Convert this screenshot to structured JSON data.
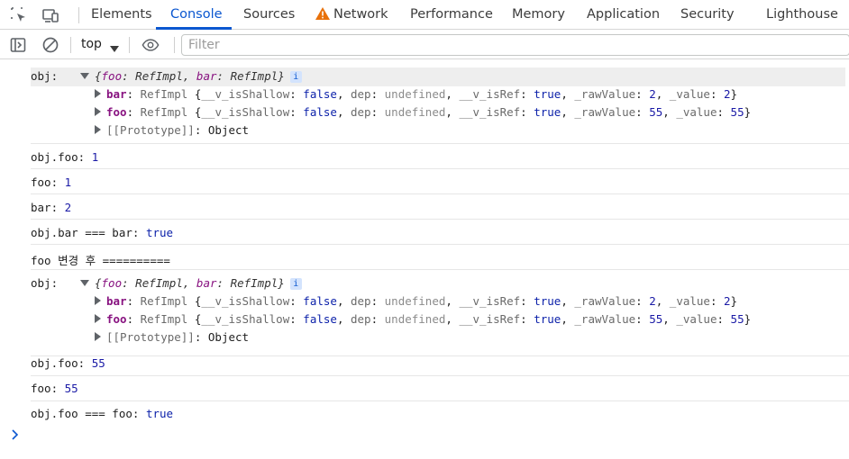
{
  "tabbar": {
    "tabs": [
      {
        "label": "Elements"
      },
      {
        "label": "Console"
      },
      {
        "label": "Sources"
      },
      {
        "label": "Network"
      },
      {
        "label": "Performance"
      },
      {
        "label": "Memory"
      },
      {
        "label": "Application"
      },
      {
        "label": "Security"
      },
      {
        "label": "Lighthouse"
      }
    ],
    "active_tab": "Console",
    "accent_color": "#0b57d0",
    "warning_color": "#e8710a"
  },
  "toolbar": {
    "context": "top",
    "filter_placeholder": "Filter"
  },
  "console": {
    "messages": [
      {
        "label": "obj:",
        "summary": {
          "open": "{",
          "k1": "foo",
          "v1": "RefImpl",
          "k2": "bar",
          "v2": "RefImpl",
          "close": "}",
          "info": "i"
        },
        "props": [
          {
            "key": "bar",
            "type": "RefImpl",
            "isShallow": "false",
            "dep": "undefined",
            "isRef": "true",
            "rawValue": "2",
            "value": "2"
          },
          {
            "key": "foo",
            "type": "RefImpl",
            "isShallow": "false",
            "dep": "undefined",
            "isRef": "true",
            "rawValue": "55",
            "value": "55"
          }
        ],
        "prototype": {
          "key": "[[Prototype]]",
          "value": "Object"
        }
      },
      {
        "label": "obj.foo:",
        "value": "1"
      },
      {
        "label": "foo:",
        "value": "1"
      },
      {
        "label": "bar:",
        "value": "2"
      },
      {
        "label": "obj.bar === bar:",
        "value": "true"
      },
      {
        "label": "foo 변경 후 =========="
      },
      {
        "label": "obj:",
        "summary": {
          "open": "{",
          "k1": "foo",
          "v1": "RefImpl",
          "k2": "bar",
          "v2": "RefImpl",
          "close": "}",
          "info": "i"
        },
        "props": [
          {
            "key": "bar",
            "type": "RefImpl",
            "isShallow": "false",
            "dep": "undefined",
            "isRef": "true",
            "rawValue": "2",
            "value": "2"
          },
          {
            "key": "foo",
            "type": "RefImpl",
            "isShallow": "false",
            "dep": "undefined",
            "isRef": "true",
            "rawValue": "55",
            "value": "55"
          }
        ],
        "prototype": {
          "key": "[[Prototype]]",
          "value": "Object"
        }
      },
      {
        "label": "obj.foo:",
        "value": "55"
      },
      {
        "label": "foo:",
        "value": "55"
      },
      {
        "label": "obj.foo === foo:",
        "value": "true"
      }
    ],
    "prop_keys": {
      "isShallow": "__v_isShallow",
      "dep": "dep",
      "isRef": "__v_isRef",
      "rawValue": "_rawValue",
      "value": "_value"
    }
  }
}
